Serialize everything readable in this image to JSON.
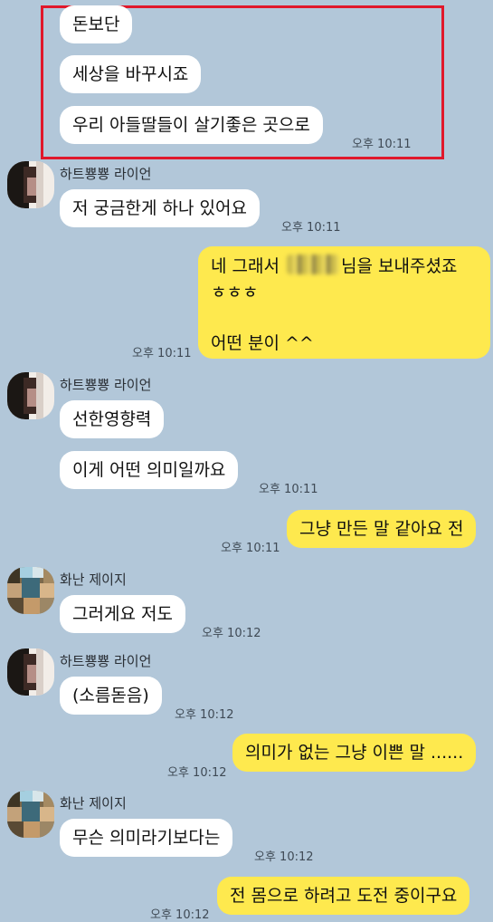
{
  "chat": {
    "prior": {
      "m1": "돈보단",
      "m2": "세상을 바꾸시죠",
      "m3": "우리 아들딸들이 살기좋은 곳으로",
      "time": "오후 10:11"
    },
    "g1": {
      "sender": "하트뿅뿅 라이언",
      "m1": "저 궁금한게 하나 있어요",
      "time": "오후 10:11"
    },
    "me1": {
      "line1_before": "네 그래서",
      "line1_after": "님을 보내주셨죠",
      "line2": "ㅎㅎㅎ",
      "line3": "어떤 분이 ^^",
      "time": "오후 10:11"
    },
    "g2": {
      "sender": "하트뿅뿅 라이언",
      "m1": "선한영향력",
      "m2": "이게 어떤 의미일까요",
      "time": "오후 10:11"
    },
    "me2": {
      "m1": "그냥 만든 말 같아요 전",
      "time": "오후 10:11"
    },
    "g3": {
      "sender": "화난 제이지",
      "m1": "그러게요 저도",
      "time": "오후 10:12"
    },
    "g4": {
      "sender": "하트뿅뿅 라이언",
      "m1": "(소름돋음)",
      "time": "오후 10:12"
    },
    "me3": {
      "m1": "의미가 없는 그냥 이쁜 말 ......",
      "time": "오후 10:12"
    },
    "g5": {
      "sender": "화난 제이지",
      "m1": "무슨 의미라기보다는",
      "time": "오후 10:12"
    },
    "me4": {
      "m1": "전 몸으로 하려고 도전 중이구요",
      "time": "오후 10:12"
    }
  },
  "colors": {
    "background": "#b2c7d9",
    "incoming_bubble": "#ffffff",
    "outgoing_bubble": "#fee94e",
    "highlight_border": "#e0182b"
  }
}
